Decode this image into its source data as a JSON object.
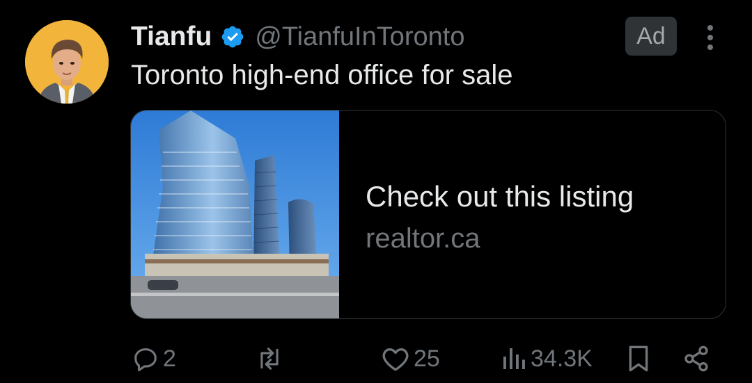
{
  "author": {
    "display_name": "Tianfu",
    "handle": "@TianfuInToronto",
    "avatar_icon": "profile-photo"
  },
  "ad_label": "Ad",
  "tweet_text": "Toronto high-end office for sale",
  "card": {
    "title": "Check out this listing",
    "domain": "realtor.ca",
    "image_icon": "office-tower-photo"
  },
  "actions": {
    "replies": "2",
    "likes": "25",
    "views": "34.3K"
  },
  "colors": {
    "background": "#000000",
    "text_primary": "#e7e9ea",
    "text_secondary": "#71767b",
    "verified_blue": "#1d9bf0",
    "avatar_bg": "#f2b43a"
  }
}
